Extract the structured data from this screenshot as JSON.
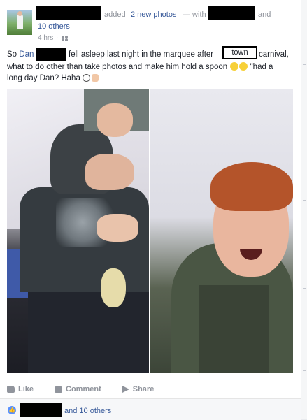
{
  "post": {
    "header": {
      "action_text": "added",
      "photos_link": "2 new photos",
      "with_text": "— with",
      "and_text": "and",
      "others_link": "10 others",
      "time": "4 hrs",
      "audience_icon": "friends-icon"
    },
    "body": {
      "line1_so": "So",
      "line1_dan": "Dan",
      "line1_mid": "fell asleep last night in the marquee after",
      "town": "town",
      "line1_end": "carnival,",
      "line2": "what to do other than take photos and make him hold a spoon",
      "line2_quote": "\"had a",
      "line3": "long day Dan? Haha"
    },
    "actions": {
      "like": "Like",
      "comment": "Comment",
      "share": "Share"
    },
    "reactions": {
      "and_others": "and 10 others"
    }
  },
  "colors": {
    "link": "#365899",
    "muted": "#90949c",
    "like_badge": "#5890ff"
  }
}
